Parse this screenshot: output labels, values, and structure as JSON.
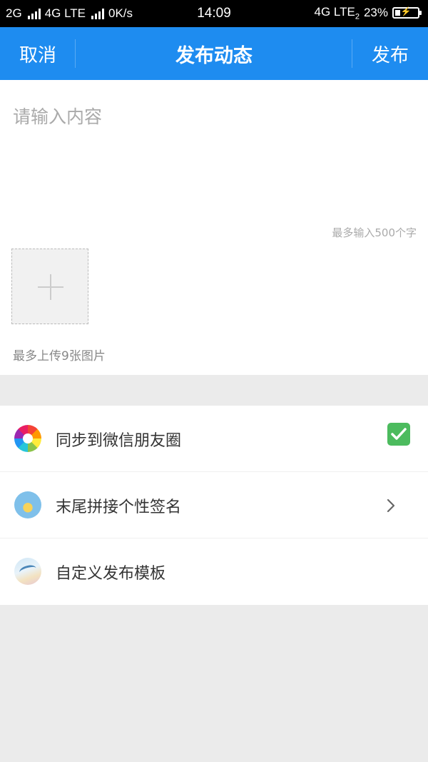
{
  "status_bar": {
    "sim1": "2G",
    "sim1_lte": "4G LTE",
    "net_speed": "0K/s",
    "time": "14:09",
    "sim2": "4G LTE",
    "sim2_index": "2",
    "battery": "23%",
    "battery_level": 0.23
  },
  "navbar": {
    "cancel_label": "取消",
    "title": "发布动态",
    "publish_label": "发布"
  },
  "editor": {
    "placeholder": "请输入内容",
    "value": "",
    "char_limit": "最多输入500个字",
    "upload_hint": "最多上传9张图片"
  },
  "options": [
    {
      "label": "同步到微信朋友圈",
      "icon": "wechat-moments-icon",
      "control": "checkbox",
      "checked": true
    },
    {
      "label": "末尾拼接个性签名",
      "icon": "signature-icon",
      "control": "chevron"
    },
    {
      "label": "自定义发布模板",
      "icon": "template-icon",
      "control": "none"
    }
  ],
  "colors": {
    "accent": "#1e8cf0",
    "checkbox": "#4cbb5e",
    "page_bg": "#ebebeb"
  }
}
